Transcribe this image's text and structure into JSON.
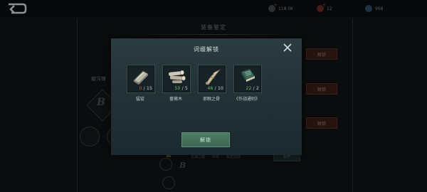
{
  "topbar": {
    "currencies": [
      {
        "icon": "gold-coin-icon",
        "value": "118.0K"
      },
      {
        "icon": "red-gem-icon",
        "value": "12"
      },
      {
        "icon": "blue-gem-icon",
        "value": "968"
      }
    ]
  },
  "background": {
    "title": "装备鉴定",
    "weapon_label": "疫污锋",
    "grade_letter": "B",
    "unlock_label": "解锁",
    "row_text_1": "云渊之眼",
    "row_text_2": "特攻",
    "row_text_3": "属性加成",
    "row_button": "替换"
  },
  "modal": {
    "title": "词缀解锁",
    "confirm_label": "解锁",
    "items": [
      {
        "name": "猛锭",
        "have": "0",
        "need": "15",
        "status": "insufficient",
        "icon": "ingot-icon"
      },
      {
        "name": "蔷薇木",
        "have": "50",
        "need": "5",
        "status": "enough",
        "icon": "wood-log-icon"
      },
      {
        "name": "邪眼之骨",
        "have": "46",
        "need": "10",
        "status": "enough",
        "icon": "bone-claw-icon"
      },
      {
        "name": "《作战通则》",
        "have": "22",
        "need": "2",
        "status": "enough",
        "icon": "manual-book-icon"
      }
    ]
  },
  "colors": {
    "insufficient": "#d94c3b",
    "enough": "#68c36c",
    "confirm_button": "#4f7c66"
  }
}
